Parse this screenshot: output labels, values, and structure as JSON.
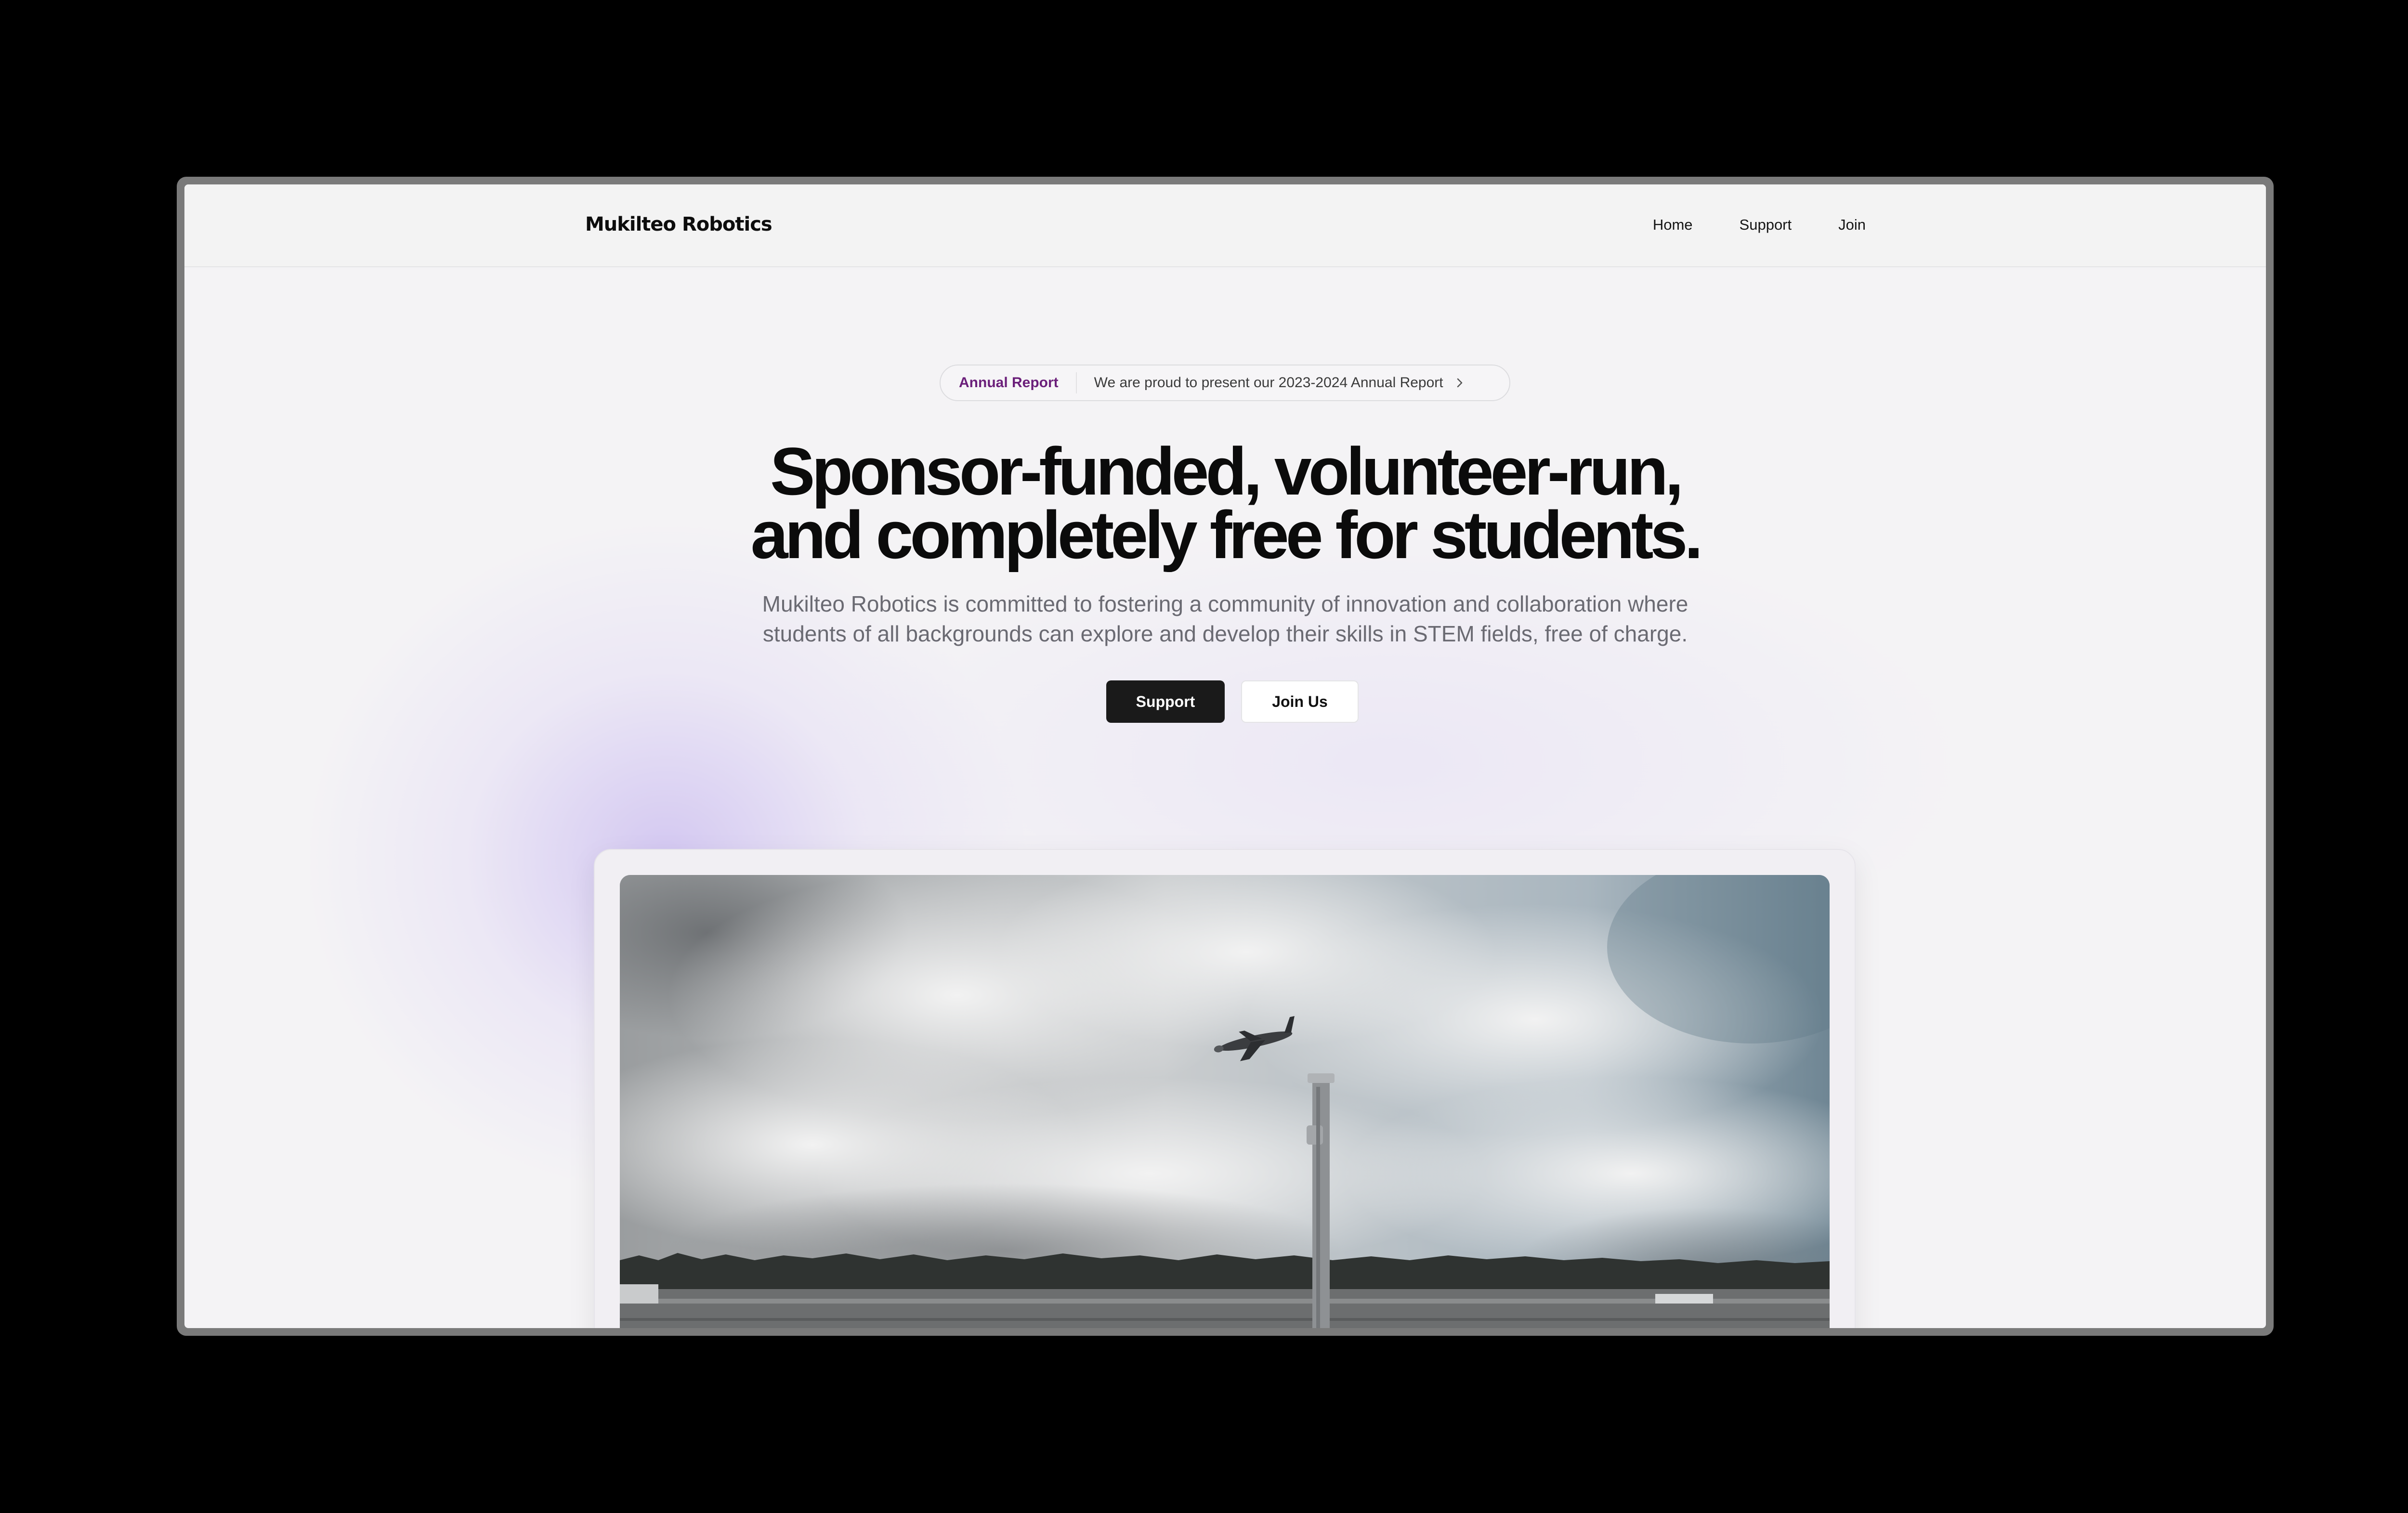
{
  "site": {
    "brand": "Mukilteo Robotics"
  },
  "nav": {
    "items": [
      {
        "label": "Home"
      },
      {
        "label": "Support"
      },
      {
        "label": "Join"
      }
    ]
  },
  "announcement": {
    "tag": "Annual Report",
    "message": "We are proud to present our 2023-2024 Annual Report",
    "icon": "chevron-right-icon",
    "tag_color": "#6b1f7a"
  },
  "hero": {
    "headline_line1": "Sponsor-funded, volunteer-run,",
    "headline_line2": "and completely free for students.",
    "sub_line1": "Mukilteo Robotics is committed to fostering a community of innovation and collaboration where",
    "sub_line2": "students of all backgrounds can explore and develop their skills in STEM fields, free of charge.",
    "primary_cta": "Support",
    "secondary_cta": "Join Us"
  },
  "colors": {
    "background": "#f4f3f5",
    "accent_glow": "#c8b9f0",
    "primary_button": "#1a1a1a"
  }
}
